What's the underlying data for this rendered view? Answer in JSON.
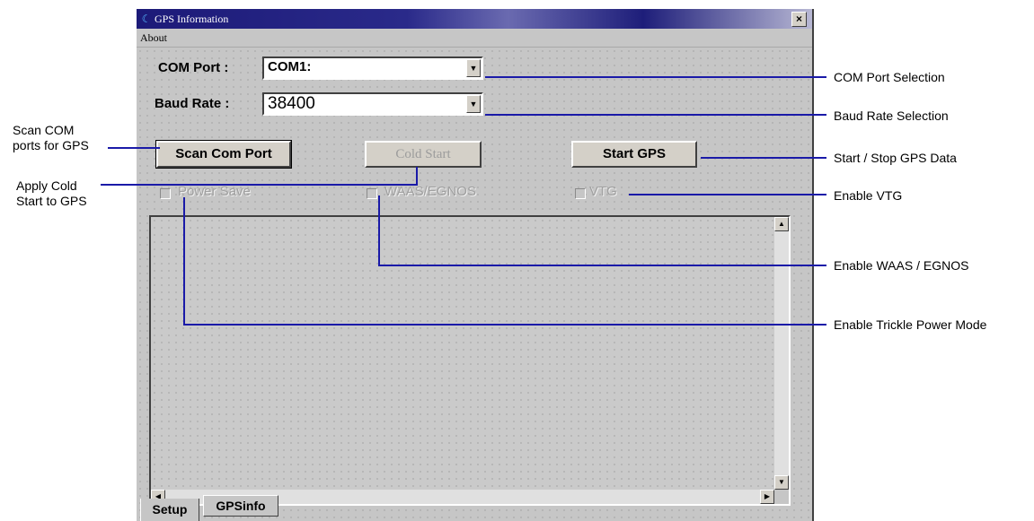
{
  "window": {
    "title": "GPS Information",
    "close_glyph": "×"
  },
  "menu": {
    "about": "About"
  },
  "com_port": {
    "label": "COM Port :",
    "value": "COM1:"
  },
  "baud_rate": {
    "label": "Baud Rate :",
    "value": "38400"
  },
  "buttons": {
    "scan": "Scan Com Port",
    "cold_start": "Cold Start",
    "start_gps": "Start GPS"
  },
  "checkboxes": {
    "power_save": "Power Save",
    "waas": "WAAS/EGNOS",
    "vtg": "VTG"
  },
  "tabs": [
    {
      "label": "Setup"
    },
    {
      "label": "GPSinfo"
    }
  ],
  "annotations": {
    "scan": "Scan COM\nports for GPS",
    "cold_start": "Apply Cold\nStart to GPS",
    "com_port": "COM Port Selection",
    "baud_rate": "Baud Rate Selection",
    "start_stop": "Start / Stop GPS Data",
    "vtg": "Enable VTG",
    "waas": "Enable WAAS / EGNOS",
    "trickle": "Enable Trickle Power Mode"
  },
  "colors": {
    "callout_line": "#1a1aa8",
    "titlebar": "#1c1a78",
    "window_bg": "#c6c6c6"
  },
  "icons": {
    "dropdown": "chevron-down-icon",
    "scroll_up": "arrow-up-icon",
    "scroll_down": "arrow-down-icon",
    "scroll_left": "arrow-left-icon",
    "scroll_right": "arrow-right-icon"
  }
}
